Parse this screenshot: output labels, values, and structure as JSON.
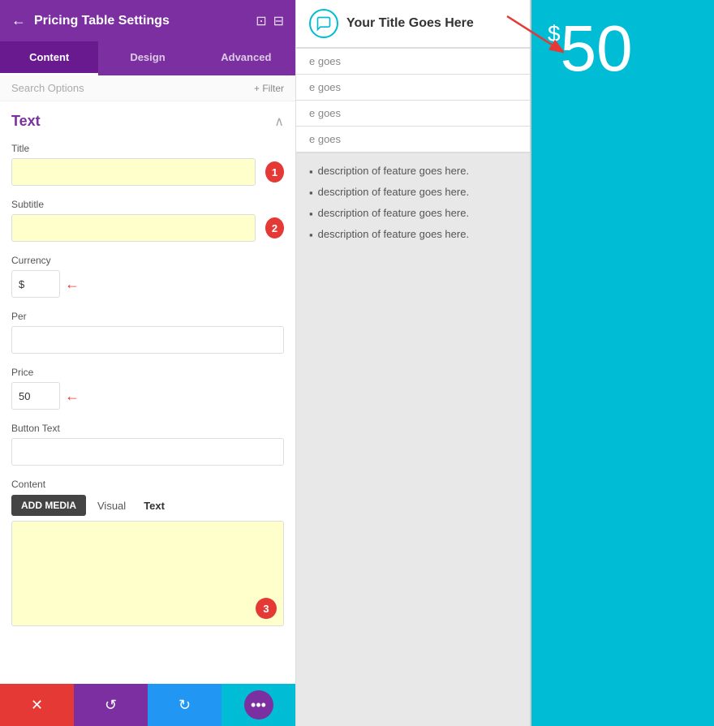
{
  "header": {
    "title": "Pricing Table Settings",
    "back_icon": "←",
    "icon1": "⊡",
    "icon2": "⊟"
  },
  "tabs": [
    {
      "label": "Content",
      "active": true
    },
    {
      "label": "Design",
      "active": false
    },
    {
      "label": "Advanced",
      "active": false
    }
  ],
  "search": {
    "placeholder": "Search Options",
    "filter_label": "+ Filter"
  },
  "section": {
    "title": "Text",
    "collapse_icon": "∧"
  },
  "fields": {
    "title_label": "Title",
    "title_value": "",
    "title_badge": "1",
    "subtitle_label": "Subtitle",
    "subtitle_value": "",
    "subtitle_badge": "2",
    "currency_label": "Currency",
    "currency_value": "$",
    "per_label": "Per",
    "per_value": "",
    "price_label": "Price",
    "price_value": "50",
    "button_text_label": "Button Text",
    "button_text_value": "",
    "content_label": "Content"
  },
  "editor": {
    "add_media_label": "ADD MEDIA",
    "visual_tab": "Visual",
    "text_tab": "Text",
    "content_badge": "3"
  },
  "bottom": {
    "close_icon": "✕",
    "undo_icon": "↺",
    "redo_icon": "↻",
    "more_icon": "•••"
  },
  "preview": {
    "title": "Your Title Goes Here",
    "currency": "$",
    "price": "50",
    "features": [
      "description of feature goes here.",
      "description of feature goes here.",
      "description of feature goes here.",
      "description of feature goes here."
    ],
    "truncated_rows": [
      "e goes",
      "e goes",
      "e goes",
      "e goes"
    ]
  }
}
